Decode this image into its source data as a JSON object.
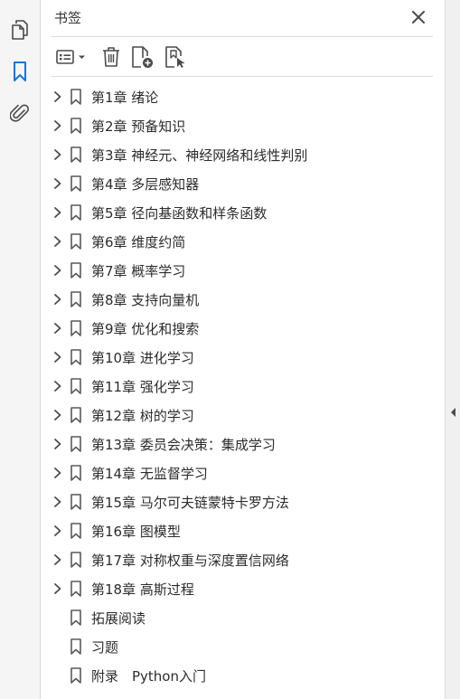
{
  "panel": {
    "title": "书签"
  },
  "rail": {
    "items": [
      {
        "name": "pages",
        "icon": "pages-icon",
        "active": false
      },
      {
        "name": "bookmarks",
        "icon": "bookmark-icon",
        "active": true
      },
      {
        "name": "attachments",
        "icon": "paperclip-icon",
        "active": false
      }
    ]
  },
  "toolbar": {
    "buttons": [
      {
        "icon": "options-menu-icon"
      },
      {
        "icon": "delete-icon"
      },
      {
        "icon": "new-bookmark-icon"
      },
      {
        "icon": "bookmark-search-icon"
      }
    ]
  },
  "bookmarks": [
    {
      "label": "第1章 绪论",
      "expandable": true
    },
    {
      "label": "第2章 预备知识",
      "expandable": true
    },
    {
      "label": "第3章 神经元、神经网络和线性判别",
      "expandable": true
    },
    {
      "label": "第4章 多层感知器",
      "expandable": true
    },
    {
      "label": "第5章 径向基函数和样条函数",
      "expandable": true
    },
    {
      "label": "第6章 维度约简",
      "expandable": true
    },
    {
      "label": "第7章 概率学习",
      "expandable": true
    },
    {
      "label": "第8章 支持向量机",
      "expandable": true
    },
    {
      "label": "第9章 优化和搜索",
      "expandable": true
    },
    {
      "label": "第10章 进化学习",
      "expandable": true
    },
    {
      "label": "第11章 强化学习",
      "expandable": true
    },
    {
      "label": "第12章 树的学习",
      "expandable": true
    },
    {
      "label": "第13章 委员会决策：集成学习",
      "expandable": true
    },
    {
      "label": "第14章 无监督学习",
      "expandable": true
    },
    {
      "label": "第15章 马尔可夫链蒙特卡罗方法",
      "expandable": true
    },
    {
      "label": "第16章 图模型",
      "expandable": true
    },
    {
      "label": "第17章 对称权重与深度置信网络",
      "expandable": true
    },
    {
      "label": "第18章 高斯过程",
      "expandable": true
    },
    {
      "label": "拓展阅读",
      "expandable": false
    },
    {
      "label": "习题",
      "expandable": false
    },
    {
      "label": "附录　Python入门",
      "expandable": false
    }
  ],
  "colors": {
    "accent": "#1473e6",
    "icon": "#4b4b4b",
    "rail_bg": "#f5f5f5"
  }
}
